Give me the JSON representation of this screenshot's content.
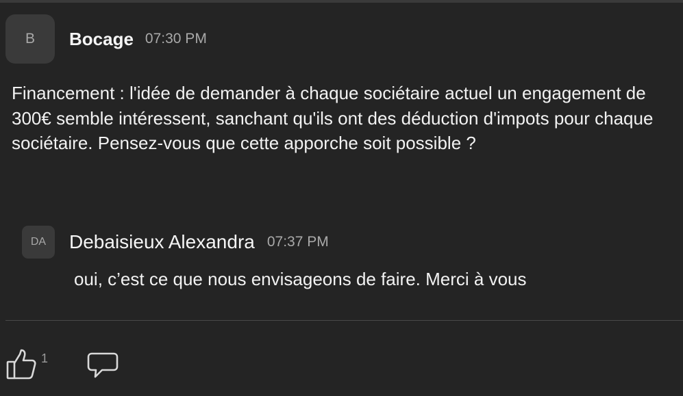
{
  "post": {
    "avatar_initial": "B",
    "author": "Bocage",
    "time": "07:30 PM",
    "body": "Financement : l'idée de demander à chaque sociétaire actuel un engagement de 300€ semble intéressent, sanchant qu'ils ont des déduction d'impots pour chaque sociétaire. Pensez-vous que cette apporche soit possible ?"
  },
  "reply": {
    "avatar_initials": "DA",
    "author": "Debaisieux Alexandra",
    "time": "07:37 PM",
    "body": "oui, c’est ce que nous envisageons de faire. Merci à vous"
  },
  "actions": {
    "like_icon": "thumbs-up-icon",
    "like_count": "1",
    "comment_icon": "comment-icon"
  },
  "colors": {
    "background": "#242424",
    "avatar_bg": "#3a3a3a",
    "text": "#f2f2f2",
    "muted": "#a9a9a9"
  }
}
